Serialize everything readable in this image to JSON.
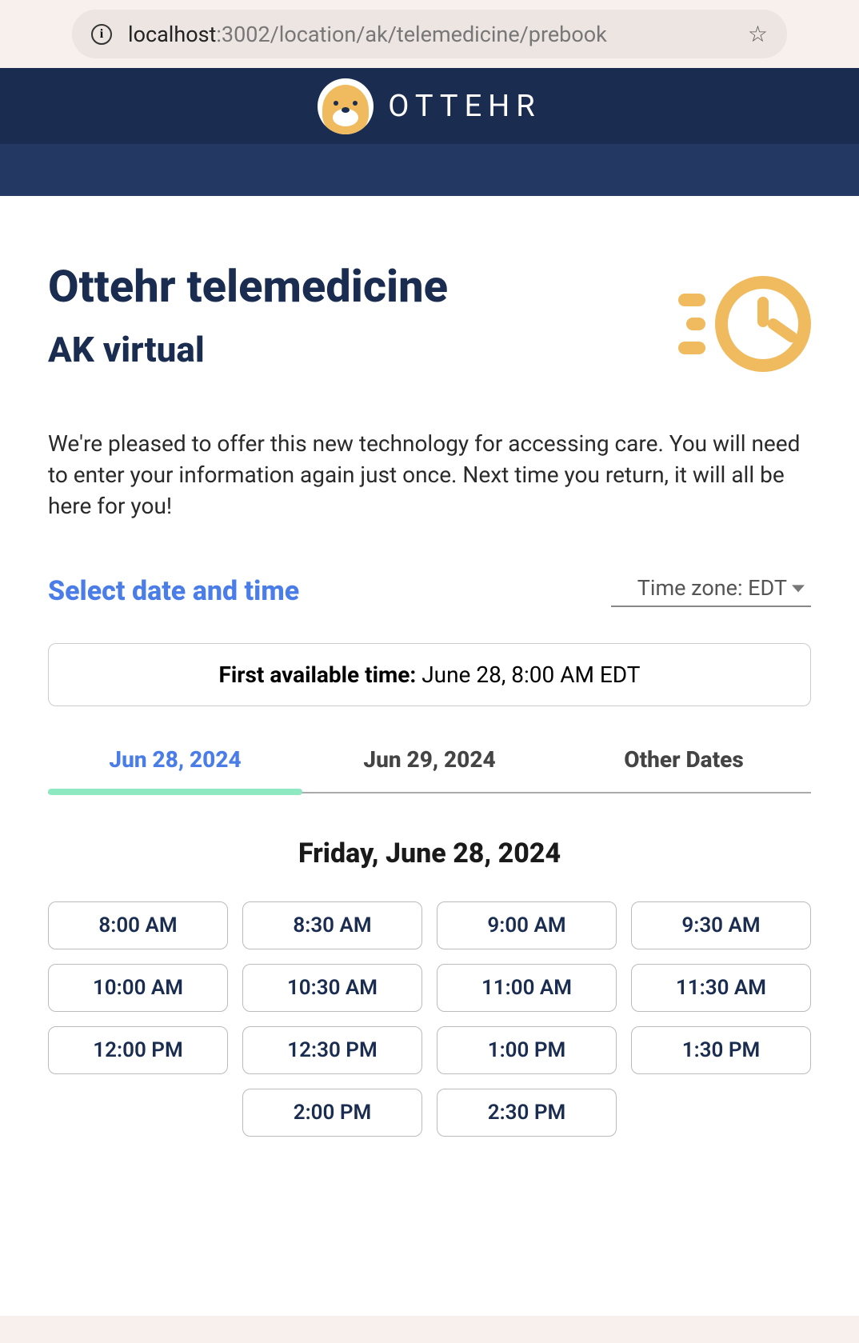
{
  "browser": {
    "url_host": "localhost",
    "url_path": ":3002/location/ak/telemedicine/prebook"
  },
  "brand": "OTTEHR",
  "page": {
    "title": "Ottehr telemedicine",
    "subtitle": "AK virtual",
    "intro": "We're pleased to offer this new technology for accessing care. You will need to enter your information again just once. Next time you return, it will all be here for you!"
  },
  "scheduler": {
    "select_label": "Select date and time",
    "timezone_label": "Time zone: EDT",
    "first_available_label": "First available time:",
    "first_available_value": " June 28, 8:00 AM EDT",
    "tabs": [
      {
        "label": "Jun 28, 2024",
        "active": true
      },
      {
        "label": "Jun 29, 2024",
        "active": false
      },
      {
        "label": "Other Dates",
        "active": false
      }
    ],
    "selected_date_heading": "Friday, June 28, 2024",
    "slots": [
      "8:00 AM",
      "8:30 AM",
      "9:00 AM",
      "9:30 AM",
      "10:00 AM",
      "10:30 AM",
      "11:00 AM",
      "11:30 AM",
      "12:00 PM",
      "12:30 PM",
      "1:00 PM",
      "1:30 PM",
      "2:00 PM",
      "2:30 PM"
    ]
  }
}
